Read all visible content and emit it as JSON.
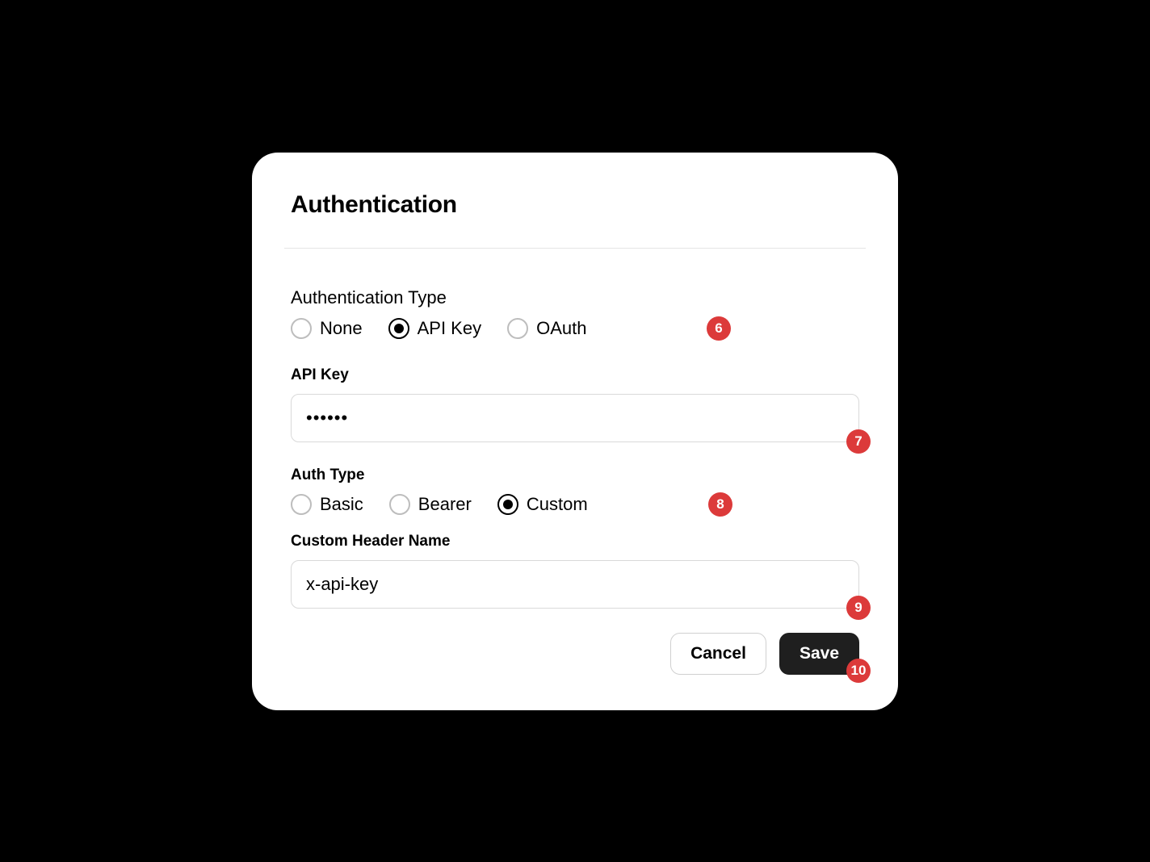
{
  "panel": {
    "title": "Authentication",
    "sections": {
      "authType": {
        "label": "Authentication Type",
        "options": {
          "none": "None",
          "apiKey": "API Key",
          "oauth": "OAuth"
        },
        "selected": "API Key",
        "badge": "6"
      },
      "apiKey": {
        "label": "API Key",
        "value": "••••••",
        "badge": "7"
      },
      "authSubType": {
        "label": "Auth Type",
        "options": {
          "basic": "Basic",
          "bearer": "Bearer",
          "custom": "Custom"
        },
        "selected": "Custom",
        "badge": "8"
      },
      "customHeader": {
        "label": "Custom Header Name",
        "value": "x-api-key",
        "badge": "9"
      }
    },
    "actions": {
      "cancel": "Cancel",
      "save": "Save",
      "badge": "10"
    }
  }
}
